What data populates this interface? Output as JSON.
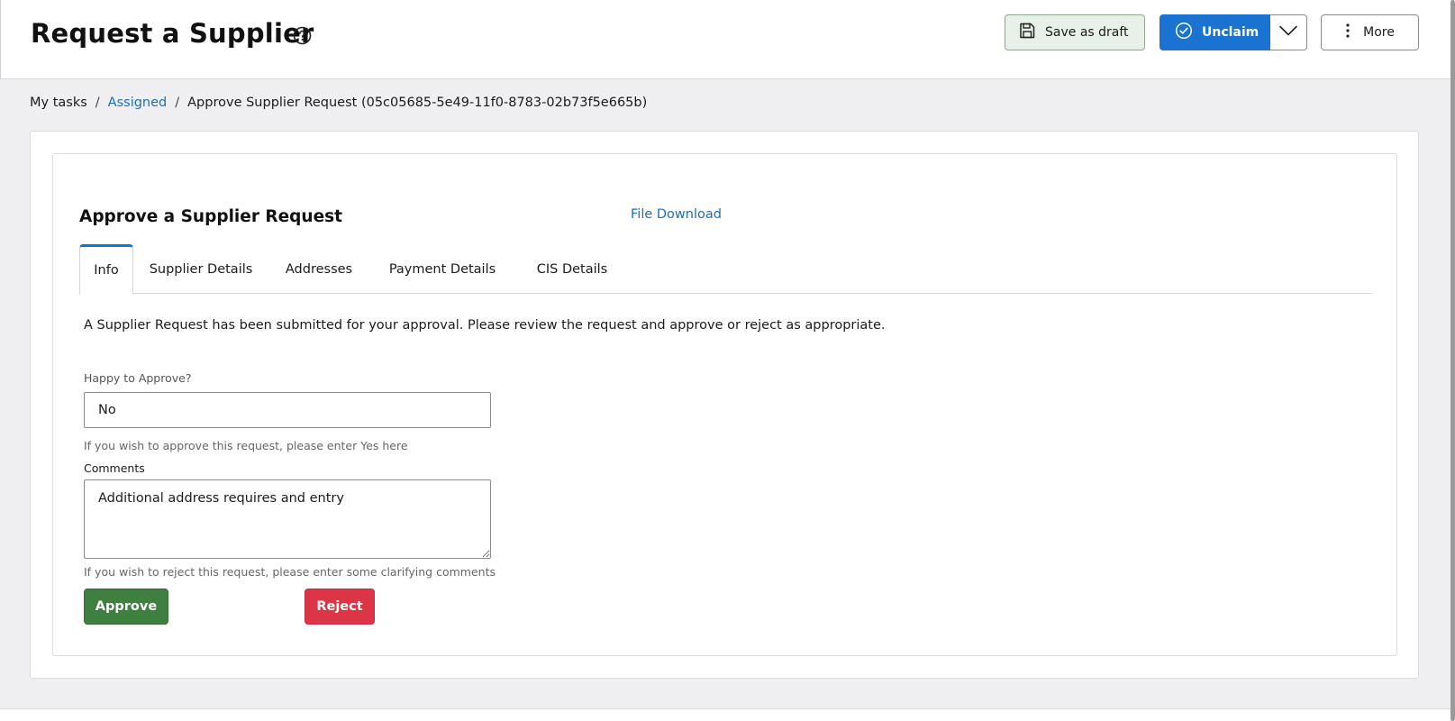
{
  "header": {
    "title": "Request a Supplier",
    "help_icon": "question-circle-icon",
    "save_draft_label": "Save as draft",
    "unclaim_label": "Unclaim",
    "more_label": "More"
  },
  "breadcrumb": {
    "items": [
      "My tasks",
      "Assigned",
      "Approve Supplier Request (05c05685-5e49-11f0-8783-02b73f5e665b)"
    ],
    "separator": "/"
  },
  "form": {
    "title": "Approve a Supplier Request",
    "file_download": "File Download",
    "tabs": [
      "Info",
      "Supplier Details",
      "Addresses",
      "Payment Details",
      "CIS Details"
    ],
    "active_tab": "Info",
    "info_text": "A Supplier Request has been submitted for your approval. Please review the request and approve or reject as appropriate.",
    "happy_label": "Happy to Approve?",
    "happy_value": "No",
    "happy_hint": "If you wish to approve this request, please enter Yes here",
    "comments_label": "Comments",
    "comments_value": "Additional address requires and entry",
    "comments_hint": "If you wish to reject this request, please enter some clarifying comments",
    "approve_label": "Approve",
    "reject_label": "Reject"
  },
  "colors": {
    "primary": "#1a73d0",
    "approve": "#3f7f3f",
    "reject": "#dc3545",
    "link": "#1a6ec0"
  }
}
